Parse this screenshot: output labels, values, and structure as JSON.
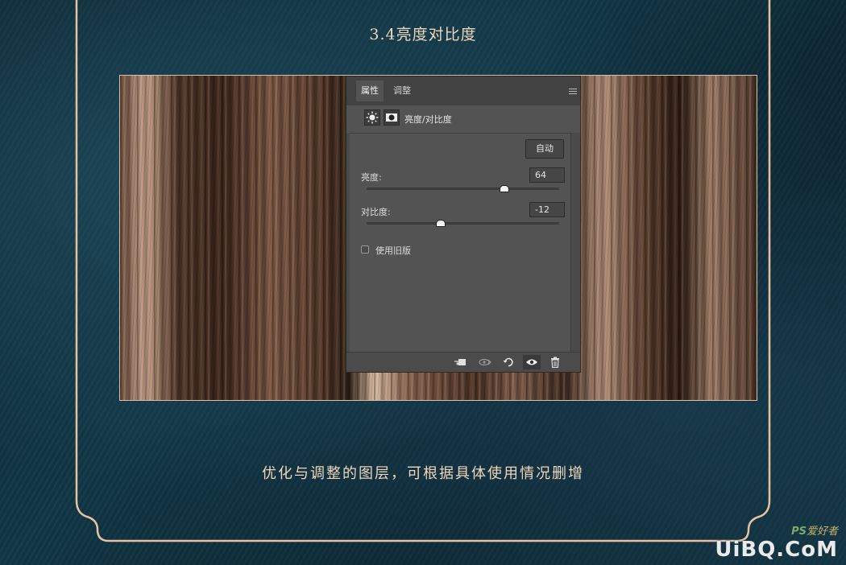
{
  "page": {
    "title": "3.4亮度对比度",
    "caption": "优化与调整的图层，可根据具体使用情况删增"
  },
  "panel": {
    "tabs": [
      {
        "label": "属性",
        "active": true
      },
      {
        "label": "调整",
        "active": false
      }
    ],
    "adjustment_title": "亮度/对比度",
    "auto_button": "自动",
    "brightness": {
      "label": "亮度:",
      "value": "64",
      "slider_fraction": 0.71
    },
    "contrast": {
      "label": "对比度:",
      "value": "-12",
      "slider_fraction": 0.38
    },
    "legacy": {
      "label": "使用旧版",
      "checked": false
    },
    "footer_icons": [
      "clip-to-layer-icon",
      "view-previous-state-icon",
      "reset-icon",
      "visibility-eye-icon",
      "trash-icon"
    ]
  },
  "watermark": {
    "top": "PS",
    "top_rest": "爱好者",
    "bottom": "UiBQ.CoM"
  },
  "colors": {
    "accent_text": "#f0d7bc",
    "frame": "#e6c2a3",
    "panel_bg": "#535353"
  }
}
